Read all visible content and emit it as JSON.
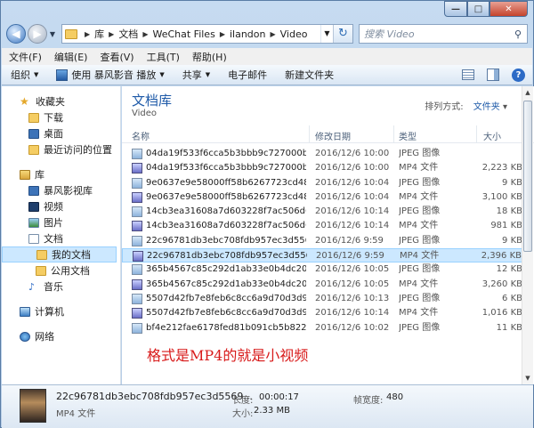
{
  "window": {
    "min_glyph": "—",
    "max_glyph": "□",
    "close_glyph": "✕"
  },
  "address": {
    "crumbs": [
      "库",
      "文档",
      "WeChat Files",
      "ilandon",
      "Video"
    ],
    "search_placeholder": "搜索 Video"
  },
  "menu": [
    "文件(F)",
    "编辑(E)",
    "查看(V)",
    "工具(T)",
    "帮助(H)"
  ],
  "toolbar": {
    "organize": "组织",
    "play_with": "使用 暴风影音 播放",
    "share": "共享",
    "email": "电子邮件",
    "new_folder": "新建文件夹"
  },
  "nav": {
    "favorites": "收藏夹",
    "downloads": "下载",
    "desktop": "桌面",
    "recent": "最近访问的位置",
    "libraries": "库",
    "baofeng": "暴风影视库",
    "videos": "视频",
    "pictures": "图片",
    "documents": "文档",
    "my_documents": "我的文档",
    "public_documents": "公用文档",
    "music": "音乐",
    "computer": "计算机",
    "network": "网络"
  },
  "content": {
    "title": "文档库",
    "subtitle": "Video",
    "arrange_label": "排列方式:",
    "arrange_value": "文件夹",
    "columns": [
      "名称",
      "修改日期",
      "类型",
      "大小"
    ],
    "annotation": "格式是MP4的就是小视频"
  },
  "files": [
    {
      "name": "04da19f533f6cca5b3bbb9c727000b9...",
      "date": "2016/12/6 10:00",
      "type": "JPEG 图像",
      "size": "",
      "kind": "jpeg"
    },
    {
      "name": "04da19f533f6cca5b3bbb9c727000b9...",
      "date": "2016/12/6 10:00",
      "type": "MP4 文件",
      "size": "2,223 KB",
      "kind": "mp4"
    },
    {
      "name": "9e0637e9e58000ff58b6267723cd480...",
      "date": "2016/12/6 10:04",
      "type": "JPEG 图像",
      "size": "9 KB",
      "kind": "jpeg"
    },
    {
      "name": "9e0637e9e58000ff58b6267723cd480...",
      "date": "2016/12/6 10:04",
      "type": "MP4 文件",
      "size": "3,100 KB",
      "kind": "mp4"
    },
    {
      "name": "14cb3ea31608a7d603228f7ac506d6c...",
      "date": "2016/12/6 10:14",
      "type": "JPEG 图像",
      "size": "18 KB",
      "kind": "jpeg"
    },
    {
      "name": "14cb3ea31608a7d603228f7ac506d6c...",
      "date": "2016/12/6 10:14",
      "type": "MP4 文件",
      "size": "981 KB",
      "kind": "mp4"
    },
    {
      "name": "22c96781db3ebc708fdb957ec3d5569...",
      "date": "2016/12/6 9:59",
      "type": "JPEG 图像",
      "size": "9 KB",
      "kind": "jpeg"
    },
    {
      "name": "22c96781db3ebc708fdb957ec3d5569...",
      "date": "2016/12/6 9:59",
      "type": "MP4 文件",
      "size": "2,396 KB",
      "kind": "mp4",
      "selected": true
    },
    {
      "name": "365b4567c85c292d1ab33e0b4dc208...",
      "date": "2016/12/6 10:05",
      "type": "JPEG 图像",
      "size": "12 KB",
      "kind": "jpeg"
    },
    {
      "name": "365b4567c85c292d1ab33e0b4dc208...",
      "date": "2016/12/6 10:05",
      "type": "MP4 文件",
      "size": "3,260 KB",
      "kind": "mp4"
    },
    {
      "name": "5507d42fb7e8feb6c8cc6a9d70d3d96...",
      "date": "2016/12/6 10:13",
      "type": "JPEG 图像",
      "size": "6 KB",
      "kind": "jpeg"
    },
    {
      "name": "5507d42fb7e8feb6c8cc6a9d70d3d96...",
      "date": "2016/12/6 10:14",
      "type": "MP4 文件",
      "size": "1,016 KB",
      "kind": "mp4"
    },
    {
      "name": "bf4e212fae6178fed81b091cb5b8227...",
      "date": "2016/12/6 10:02",
      "type": "JPEG 图像",
      "size": "11 KB",
      "kind": "jpeg"
    }
  ],
  "details": {
    "name": "22c96781db3ebc708fdb957ec3d5569...",
    "type": "MP4 文件",
    "length_label": "长度:",
    "length_value": "00:00:17",
    "size_label": "大小:",
    "size_value": "2.33 MB",
    "width_label": "帧宽度:",
    "width_value": "480"
  }
}
